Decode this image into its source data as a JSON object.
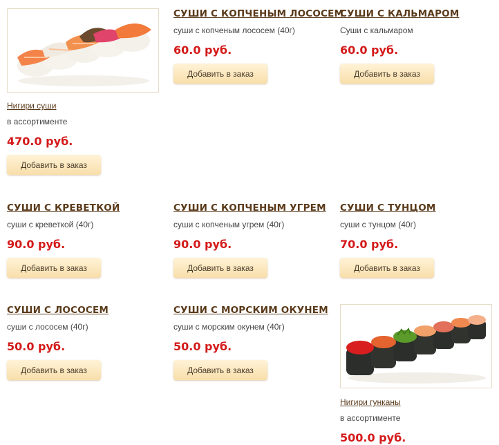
{
  "add_button_label": "Добавить в заказ",
  "items": [
    {
      "title": "Нигири суши",
      "desc": "в ассортименте",
      "price": "470.0 руб."
    },
    {
      "title": "СУШИ С КОПЧЕНЫМ ЛОСОСЕМ",
      "desc": "суши с копченым лососем (40г)",
      "price": "60.0 руб."
    },
    {
      "title": "СУШИ С КАЛЬМАРОМ",
      "desc": "Суши с кальмаром",
      "price": "60.0 руб."
    },
    {
      "title": "СУШИ С КРЕВЕТКОЙ",
      "desc": "суши с креветкой (40г)",
      "price": "90.0 руб."
    },
    {
      "title": "СУШИ С КОПЧЕНЫМ УГРЕМ",
      "desc": "суши с копченым угрем (40г)",
      "price": "90.0 руб."
    },
    {
      "title": "СУШИ С ТУНЦОМ",
      "desc": "суши с тунцом (40г)",
      "price": "70.0 руб."
    },
    {
      "title": "СУШИ С ЛОСОСЕМ",
      "desc": "суши с лососем (40г)",
      "price": "50.0 руб."
    },
    {
      "title": "СУШИ С МОРСКИМ ОКУНЕМ",
      "desc": "суши с морским окунем (40г)",
      "price": "50.0 руб."
    },
    {
      "title": "Нигири гунканы",
      "desc": "в ассортименте",
      "price": "500.0 руб."
    }
  ],
  "colors": {
    "title": "#5a3a1a",
    "price": "#d41a1a",
    "button_top": "#fff3d7",
    "button_bottom": "#f8deaa"
  }
}
